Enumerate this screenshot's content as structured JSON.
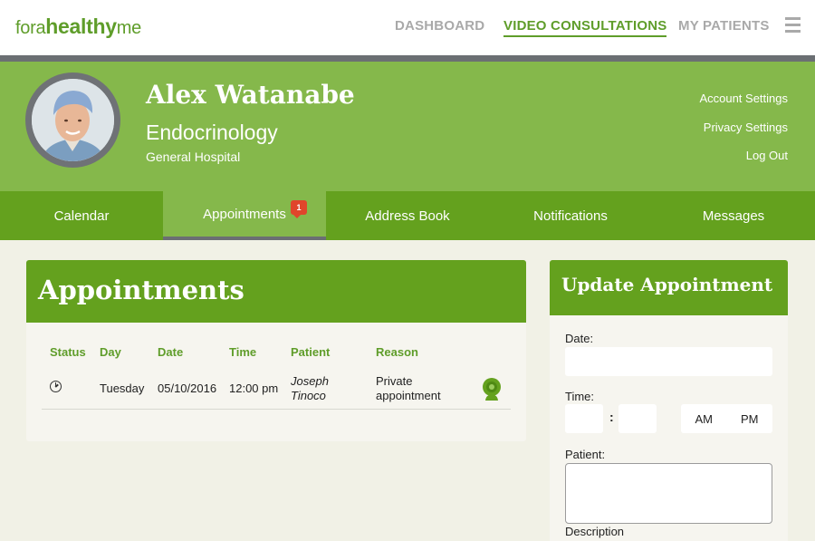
{
  "brand": {
    "prefix": "fora",
    "bold": "healthy",
    "suffix": "me",
    "color": "#5f9d2a"
  },
  "topnav": {
    "dashboard": "DASHBOARD",
    "video": "VIDEO CONSULTATIONS",
    "patients": "MY PATIENTS",
    "menu_icon": "hamburger-icon"
  },
  "profile": {
    "name": "Alex Watanabe",
    "specialty": "Endocrinology",
    "hospital": "General Hospital",
    "links": {
      "account": "Account Settings",
      "privacy": "Privacy Settings",
      "logout": "Log Out"
    }
  },
  "tabs": {
    "calendar": "Calendar",
    "appointments": "Appointments",
    "appointments_badge": "1",
    "address_book": "Address Book",
    "notifications": "Notifications",
    "messages": "Messages"
  },
  "appointments": {
    "title": "Appointments",
    "headers": {
      "status": "Status",
      "day": "Day",
      "date": "Date",
      "time": "Time",
      "patient": "Patient",
      "reason": "Reason"
    },
    "rows": [
      {
        "status_icon": "clock-icon",
        "day": "Tuesday",
        "date": "05/10/2016",
        "time": "12:00 pm",
        "patient_first": "Joseph",
        "patient_last": "Tinoco",
        "reason_line1": "Private",
        "reason_line2": "appointment",
        "action_icon": "webcam-icon"
      }
    ]
  },
  "update": {
    "title": "Update Appointment",
    "date_label": "Date:",
    "date_value": "",
    "time_label": "Time:",
    "time_colon": ":",
    "hour_value": "",
    "minute_value": "",
    "am": "AM",
    "pm": "PM",
    "patient_label": "Patient:",
    "patient_value": "",
    "description_label": "Description"
  },
  "colors": {
    "primary": "#64a11e",
    "light_green": "#85b84b",
    "grey_bar": "#6b6f73",
    "badge": "#e0452b",
    "background": "#f1f1e6"
  }
}
